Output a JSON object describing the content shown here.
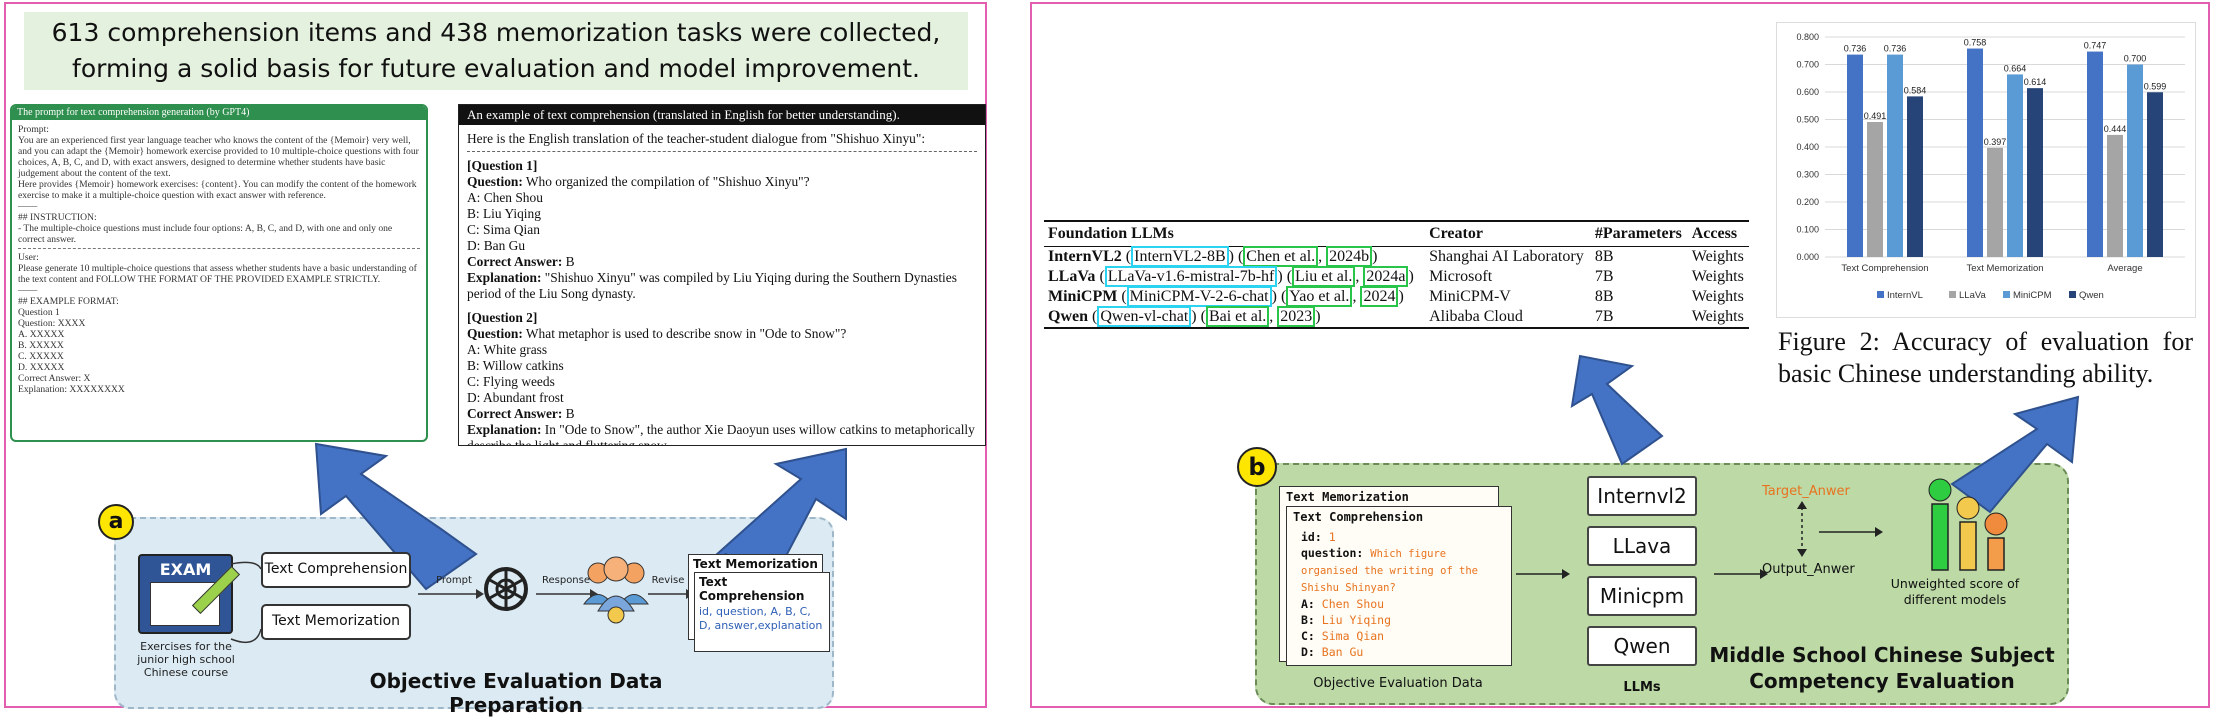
{
  "left": {
    "headline": "613 comprehension items and 438 memorization tasks were collected, forming a solid basis for future evaluation and model improvement.",
    "prompt_box": {
      "header": "The prompt for text comprehension generation (by GPT4)",
      "lines": [
        "Prompt:",
        "You are an experienced first year language teacher who knows the content of the {Memoir} very well, and you can adapt the {Memoir} homework exercise provided to 10 multiple-choice questions with four choices, A, B, C, and D, with exact answers, designed to determine whether students have basic judgement about the content of the text.",
        "Here provides {Memoir} homework exercises: {content}. You can modify the content of the homework exercise to make it a multiple-choice question with exact answer with reference.",
        "——",
        "## INSTRUCTION:",
        "- The multiple-choice questions must include four options: A, B, C, and D, with one and only one correct answer."
      ],
      "lines2": [
        "User:",
        "Please generate 10 multiple-choice questions that assess whether students have a basic understanding of the text content and FOLLOW THE FORMAT OF THE PROVIDED EXAMPLE STRICTLY.",
        "——",
        "## EXAMPLE FORMAT:",
        "Question 1",
        "Question: XXXX",
        "A. XXXXX",
        "B. XXXXX",
        "C. XXXXX",
        "D. XXXXX",
        "Correct Answer: X",
        "Explanation: XXXXXXXX"
      ]
    },
    "example_box": {
      "header": "An example of text comprehension (translated in English for better understanding).",
      "intro": "Here is the English translation of the teacher-student dialogue from \"Shishuo Xinyu\":",
      "q1_title": "[Question 1]",
      "q1_label": "Question:",
      "q1_text": "Who organized the compilation of \"Shishuo Xinyu\"?",
      "q1_options": [
        "A: Chen Shou",
        "B: Liu Yiqing",
        "C: Sima Qian",
        "D: Ban Gu"
      ],
      "q1_answer_label": "Correct Answer:",
      "q1_answer": "B",
      "q1_expl_label": "Explanation:",
      "q1_expl": "\"Shishuo Xinyu\" was compiled by Liu Yiqing during the Southern Dynasties period of the Liu Song dynasty.",
      "q2_title": "[Question 2]",
      "q2_label": "Question:",
      "q2_text": "What metaphor is used to describe snow in \"Ode to Snow\"?",
      "q2_options": [
        "A: White grass",
        "B: Willow catkins",
        "C: Flying weeds",
        "D: Abundant frost"
      ],
      "q2_answer_label": "Correct Answer:",
      "q2_answer": "B",
      "q2_expl_label": "Explanation:",
      "q2_expl": "In \"Ode to Snow\", the author Xie Daoyun uses willow catkins to metaphorically describe the light and fluttering snow."
    },
    "prep": {
      "badge": "a",
      "exam_label": "EXAM",
      "exam_caption": "Exercises for the junior high school Chinese course",
      "task1": "Text Comprehension",
      "task2": "Text Memorization",
      "prompt_label": "Prompt",
      "response_label": "Response",
      "revise_label": "Revise",
      "card_back": "Text Memorization",
      "card_front": "Text Comprehension",
      "card_fields": "id, question, A, B, C, D, answer,explanation",
      "title": "Objective Evaluation Data Preparation"
    }
  },
  "right": {
    "table": {
      "headers": [
        "Foundation LLMs",
        "Creator",
        "#Parameters",
        "Access"
      ],
      "rows": [
        {
          "name": "InternVL2",
          "model": "InternVL2-8B",
          "cite_a": "Chen et al.",
          "cite_b": "2024b",
          "creator": "Shanghai AI Laboratory",
          "params": "8B",
          "access": "Weights"
        },
        {
          "name": "LLaVa",
          "model": "LLaVa-v1.6-mistral-7b-hf",
          "cite_a": "Liu et al.",
          "cite_b": "2024a",
          "creator": "Microsoft",
          "params": "7B",
          "access": "Weights"
        },
        {
          "name": "MiniCPM",
          "model": "MiniCPM-V-2-6-chat",
          "cite_a": "Yao et al.",
          "cite_b": "2024",
          "creator": "MiniCPM-V",
          "params": "8B",
          "access": "Weights"
        },
        {
          "name": "Qwen",
          "model": "Qwen-vl-chat",
          "cite_a": "Bai et al.",
          "cite_b": "2023",
          "creator": "Alibaba Cloud",
          "params": "7B",
          "access": "Weights"
        }
      ]
    },
    "figure_caption": "Figure 2: Accuracy of evaluation for basic Chinese understanding ability.",
    "eval": {
      "badge": "b",
      "card_back": "Text Memorization",
      "card_front": "Text Comprehension",
      "id_label": "id:",
      "id_value": "1",
      "question_label": "question:",
      "question_value": "Which figure organised the writing of the Shishu Shinyan?",
      "options": [
        {
          "label": "A:",
          "value": "Chen Shou"
        },
        {
          "label": "B:",
          "value": "Liu Yiqing"
        },
        {
          "label": "C:",
          "value": "Sima Qian"
        },
        {
          "label": "D:",
          "value": "Ban Gu"
        }
      ],
      "llms": [
        "Internvl2",
        "LLava",
        "Minicpm",
        "Qwen"
      ],
      "target": "Target_Anwer",
      "output": "Output_Anwer",
      "score_caption": "Unweighted score of different models",
      "data_caption": "Objective Evaluation Data",
      "llm_caption": "LLMs",
      "title": "Middle School Chinese Subject Competency Evaluation"
    }
  },
  "chart_data": {
    "type": "bar",
    "categories": [
      "Text Comprehension",
      "Text Memorization",
      "Average"
    ],
    "series": [
      {
        "name": "InternVL",
        "color": "#4472c4",
        "values": [
          0.736,
          0.758,
          0.747
        ]
      },
      {
        "name": "LLaVa",
        "color": "#a5a5a5",
        "values": [
          0.491,
          0.397,
          0.444
        ]
      },
      {
        "name": "MiniCPM",
        "color": "#5b9bd5",
        "values": [
          0.736,
          0.664,
          0.7
        ]
      },
      {
        "name": "Qwen",
        "color": "#264478",
        "values": [
          0.584,
          0.614,
          0.599
        ]
      }
    ],
    "value_labels": [
      [
        "0.736",
        "0.491",
        "0.736",
        "0.584"
      ],
      [
        "0.758",
        "0.397",
        "0.664",
        "0.614"
      ],
      [
        "0.747",
        "0.444",
        "0.700",
        "0.599"
      ]
    ],
    "yticks": [
      "0.000",
      "0.100",
      "0.200",
      "0.300",
      "0.400",
      "0.500",
      "0.600",
      "0.700",
      "0.800"
    ],
    "ylim": [
      0,
      0.8
    ],
    "legend_position": "bottom",
    "grid": true
  }
}
